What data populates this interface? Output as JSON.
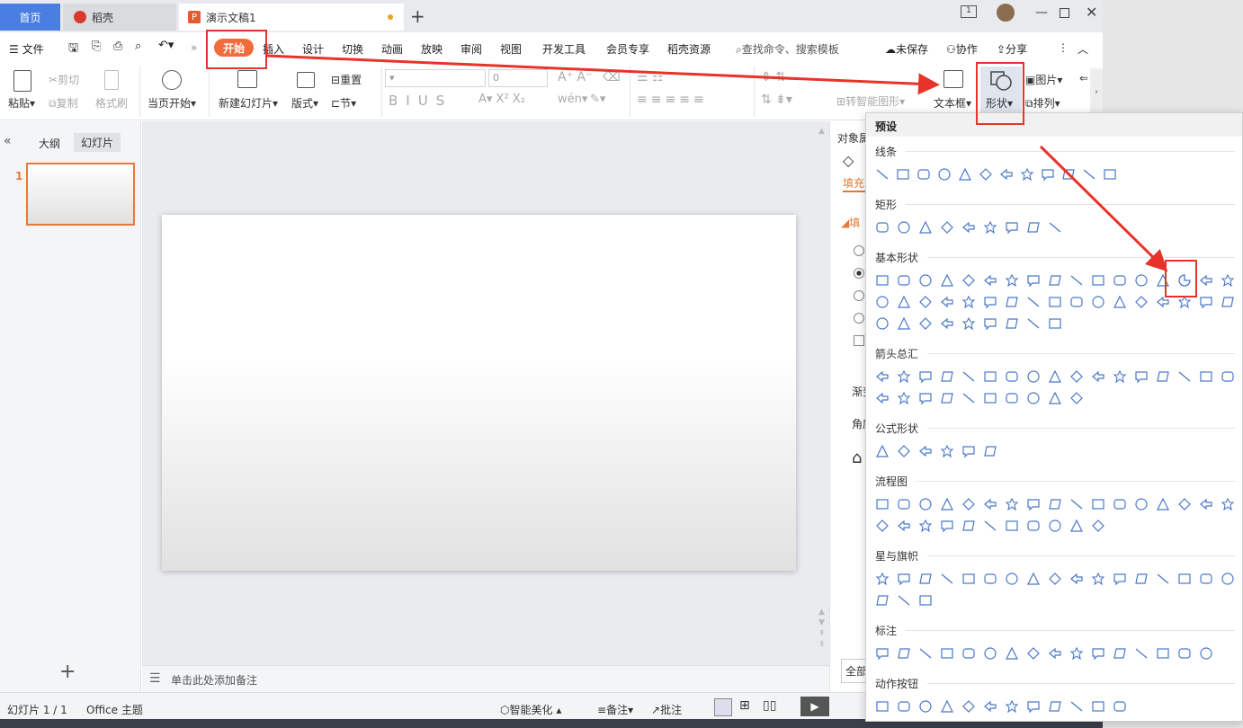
{
  "tabs": {
    "home": "首页",
    "daoke": "稻壳",
    "doc": "演示文稿1"
  },
  "menu": {
    "file": "文件",
    "items": [
      "开始",
      "插入",
      "设计",
      "切换",
      "动画",
      "放映",
      "审阅",
      "视图",
      "开发工具",
      "会员专享",
      "稻壳资源"
    ],
    "search": "查找命令、搜索模板",
    "unsaved": "未保存",
    "collab": "协作",
    "share": "分享"
  },
  "ribbon": {
    "paste": "粘贴",
    "cut": "剪切",
    "copy": "复制",
    "format_painter": "格式刷",
    "from_current": "当页开始",
    "new_slide": "新建幻灯片",
    "layout": "版式",
    "section": "节",
    "reset": "重置",
    "font_size": "0",
    "smart_shape": "转智能图形",
    "textbox": "文本框",
    "shape": "形状",
    "picture": "图片",
    "arrange": "排列"
  },
  "left": {
    "outline": "大纲",
    "slides": "幻灯片",
    "slide_num": "1"
  },
  "notes": "单击此处添加备注",
  "right": {
    "title": "对象属",
    "fill_tab": "填充",
    "fill_section": "填",
    "gradient": "渐变",
    "angle": "角度",
    "all": "全部"
  },
  "status": {
    "slide": "幻灯片 1 / 1",
    "theme": "Office 主题",
    "beautify": "智能美化",
    "notes": "备注",
    "comment": "批注"
  },
  "dropdown": {
    "header": "预设",
    "sections": [
      "线条",
      "矩形",
      "基本形状",
      "箭头总汇",
      "公式形状",
      "流程图",
      "星与旗帜",
      "标注",
      "动作按钮"
    ]
  }
}
